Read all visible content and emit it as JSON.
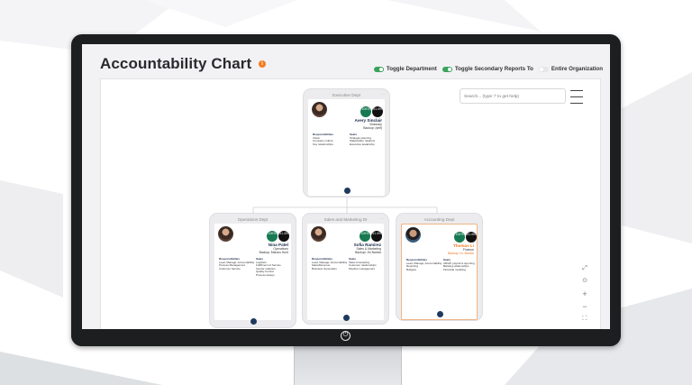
{
  "header": {
    "title": "Accountability Chart",
    "info_icon": "i",
    "toggles": [
      {
        "label": "Toggle Department",
        "on": true
      },
      {
        "label": "Toggle Secondary Reports To",
        "on": true
      },
      {
        "label": "Entire Organization",
        "on": false
      }
    ]
  },
  "search": {
    "placeholder": "Search... (type '/' to get help)"
  },
  "cards": [
    {
      "department": "Executive Dept",
      "badge1": "100%",
      "badge2": "51.4%",
      "name": "Avery Sinclair",
      "role": "Visionary",
      "backup": "Backup: (self)",
      "col_left_title": "Responsibilities",
      "col_left": [
        "Vision",
        "Company culture",
        "Key relationships"
      ],
      "col_right_title": "Seats",
      "col_right": [
        "Strategic planning",
        "Stakeholder relations",
        "Executive leadership"
      ]
    },
    {
      "department": "Operations Dept",
      "badge1": "100%",
      "badge2": "51.4%",
      "name": "Nina Patel",
      "role": "Operations",
      "backup": "Backup: Marcus Hunt",
      "col_left_title": "Responsibilities",
      "col_left": [
        "Lead, Manage, Accountability",
        "Process Management",
        "Customer Service"
      ],
      "col_right_title": "Seats",
      "col_right": [
        "Logistics",
        "Fulfillment of Service",
        "Vendor relations",
        "Quality Control",
        "Process design"
      ]
    },
    {
      "department": "Sales and Marketing Dt",
      "badge1": "100%",
      "badge2": "51.4%",
      "name": "Sofia Ramirez",
      "role": "Sales & Marketing",
      "backup": "Backup: Jin Barlow",
      "col_left_title": "Responsibilities",
      "col_left": [
        "Lead, Manage, Accountability",
        "Sales/Revenue",
        "Business Generation"
      ],
      "col_right_title": "Seats",
      "col_right": [
        "Sales forecasting",
        "Customer relationships",
        "Pipeline management"
      ]
    },
    {
      "department": "Accounting Dept",
      "badge1": "100%",
      "badge2": "51.4%",
      "name": "Thomas Li",
      "role": "Finance",
      "backup": "Backup: Dr. Barlow",
      "col_left_title": "Responsibilities",
      "col_left": [
        "Lead, Manage, Accountability",
        "Reporting",
        "Budgets"
      ],
      "col_right_title": "Seats",
      "col_right": [
        "AR/AP, payroll & reporting",
        "Banking relationships",
        "Financial modeling"
      ]
    }
  ],
  "colors": {
    "brand_orange": "#f47a20",
    "toggle_on": "#3aa35a",
    "badge_green": "#177a52",
    "node_dot": "#1d3a5e"
  },
  "icons": [
    "info-icon",
    "hamburger-icon",
    "fit-screen-icon",
    "center-icon",
    "zoom-in-icon",
    "zoom-out-icon",
    "fullscreen-icon",
    "power-icon"
  ]
}
